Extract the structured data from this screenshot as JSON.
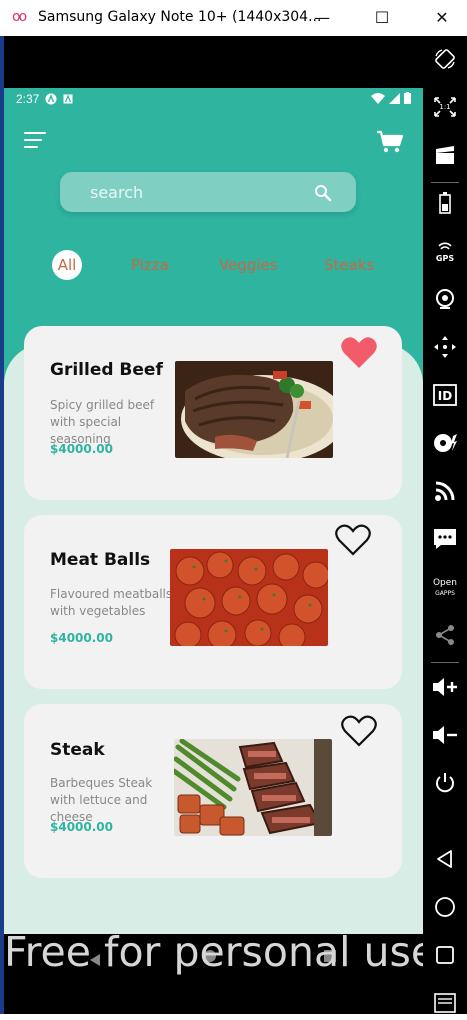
{
  "window": {
    "title": "Samsung Galaxy Note 10+ (1440x304...",
    "minimize": "—",
    "maximize": "☐",
    "close": "✕"
  },
  "status_bar": {
    "time": "2:37"
  },
  "search": {
    "placeholder": "search"
  },
  "categories": [
    {
      "label": "All",
      "active": true
    },
    {
      "label": "Pizza",
      "active": false
    },
    {
      "label": "Veggies",
      "active": false
    },
    {
      "label": "Steaks",
      "active": false
    }
  ],
  "items": [
    {
      "name": "Grilled Beef",
      "description": "Spicy grilled beef with  special seasoning",
      "price": "$4000.00",
      "favorite": true
    },
    {
      "name": "Meat Balls",
      "description": "Flavoured meatballs  with vegetables",
      "price": "$4000.00",
      "favorite": false
    },
    {
      "name": "Steak",
      "description": "Barbeques Steak with lettuce and cheese",
      "price": "$4000.00",
      "favorite": false
    }
  ],
  "colors": {
    "primary": "#2fb4a0",
    "background": "#d7ede5",
    "card": "#f2f2f2",
    "favorite": "#f25b6a",
    "category_text": "#c46a44"
  },
  "watermark": "Free for personal use",
  "toolbar": {
    "icons": [
      "rotate-icon",
      "resize-icon",
      "camera-clapper-icon",
      "battery-icon",
      "gps-icon",
      "webcam-icon",
      "move-icon",
      "id-icon",
      "media-icon",
      "rss-icon",
      "sms-icon",
      "open-gapps-icon",
      "share-icon",
      "volume-up-icon",
      "volume-down-icon",
      "power-icon",
      "back-icon",
      "home-icon",
      "recents-icon",
      "menu-icon"
    ],
    "gps_label": "GPS",
    "id_label": "ID",
    "open_label": "Open",
    "gapps_label": "GAPPS"
  }
}
